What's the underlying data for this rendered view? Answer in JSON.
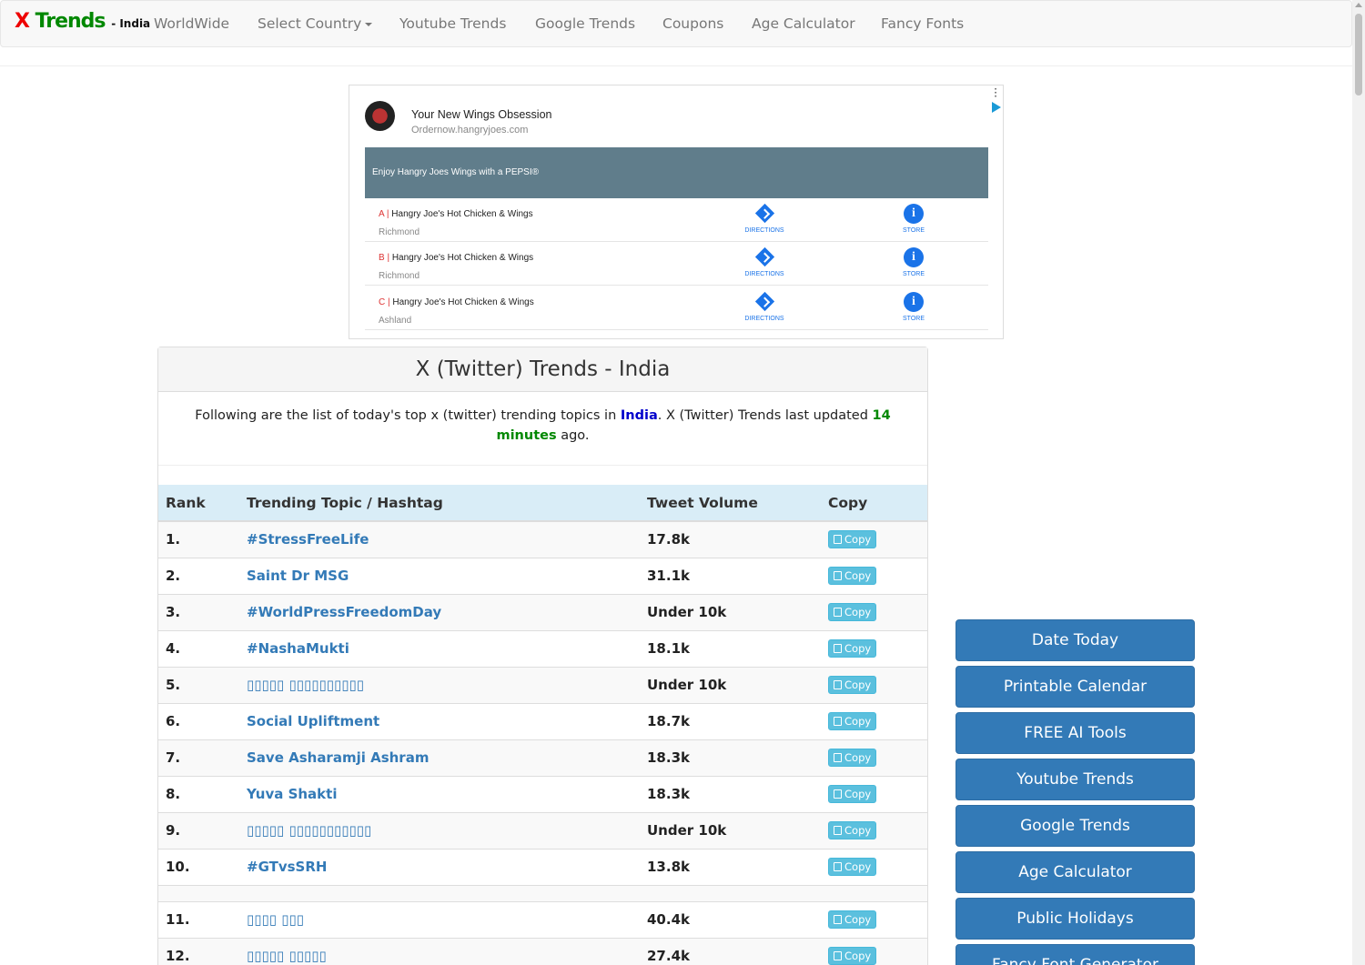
{
  "brand": {
    "x": "X",
    "trends": "Trends",
    "country": "- India"
  },
  "nav": {
    "worldwide": "WorldWide",
    "select_country": "Select Country",
    "youtube": "Youtube Trends",
    "google": "Google Trends",
    "coupons": "Coupons",
    "age": "Age Calculator",
    "fonts": "Fancy Fonts"
  },
  "ad": {
    "title": "Your New Wings Obsession",
    "url": "Ordernow.hangryjoes.com",
    "banner": "Enjoy Hangry Joes Wings with a PEPSI®",
    "directions_label": "DIRECTIONS",
    "store_label": "STORE",
    "locations": [
      {
        "letter": "A",
        "name": "Hangry Joe's Hot Chicken & Wings",
        "city": "Richmond"
      },
      {
        "letter": "B",
        "name": "Hangry Joe's Hot Chicken & Wings",
        "city": "Richmond"
      },
      {
        "letter": "C",
        "name": "Hangry Joe's Hot Chicken & Wings",
        "city": "Ashland"
      }
    ]
  },
  "panel": {
    "title": "X (Twitter) Trends - India",
    "intro_a": "Following are the list of today's top x (twitter) trending topics in ",
    "intro_country": "India",
    "intro_b": ". X (Twitter) Trends last updated ",
    "intro_time": "14 minutes",
    "intro_c": " ago."
  },
  "table": {
    "headers": {
      "rank": "Rank",
      "topic": "Trending Topic / Hashtag",
      "volume": "Tweet Volume",
      "copy": "Copy"
    },
    "copy_label": "Copy",
    "rows": [
      {
        "rank": "1.",
        "topic": "#StressFreeLife",
        "volume": "17.8k"
      },
      {
        "rank": "2.",
        "topic": "Saint Dr MSG",
        "volume": "31.1k"
      },
      {
        "rank": "3.",
        "topic": "#WorldPressFreedomDay",
        "volume": "Under 10k"
      },
      {
        "rank": "4.",
        "topic": "#NashaMukti",
        "volume": "18.1k"
      },
      {
        "rank": "5.",
        "topic": "▯▯▯▯▯ ▯▯▯▯▯▯▯▯▯▯",
        "volume": "Under 10k"
      },
      {
        "rank": "6.",
        "topic": "Social Upliftment",
        "volume": "18.7k"
      },
      {
        "rank": "7.",
        "topic": "Save Asharamji Ashram",
        "volume": "18.3k"
      },
      {
        "rank": "8.",
        "topic": "Yuva Shakti",
        "volume": "18.3k"
      },
      {
        "rank": "9.",
        "topic": "▯▯▯▯▯ ▯▯▯▯▯▯▯▯▯▯▯",
        "volume": "Under 10k"
      },
      {
        "rank": "10.",
        "topic": "#GTvsSRH",
        "volume": "13.8k"
      },
      {
        "rank": "11.",
        "topic": "▯▯▯▯ ▯▯▯",
        "volume": "40.4k"
      },
      {
        "rank": "12.",
        "topic": "▯▯▯▯▯ ▯▯▯▯▯",
        "volume": "27.4k"
      }
    ]
  },
  "sidebar": [
    "Date Today",
    "Printable Calendar",
    "FREE AI Tools",
    "Youtube Trends",
    "Google Trends",
    "Age Calculator",
    "Public Holidays",
    "Fancy Font Generator"
  ]
}
